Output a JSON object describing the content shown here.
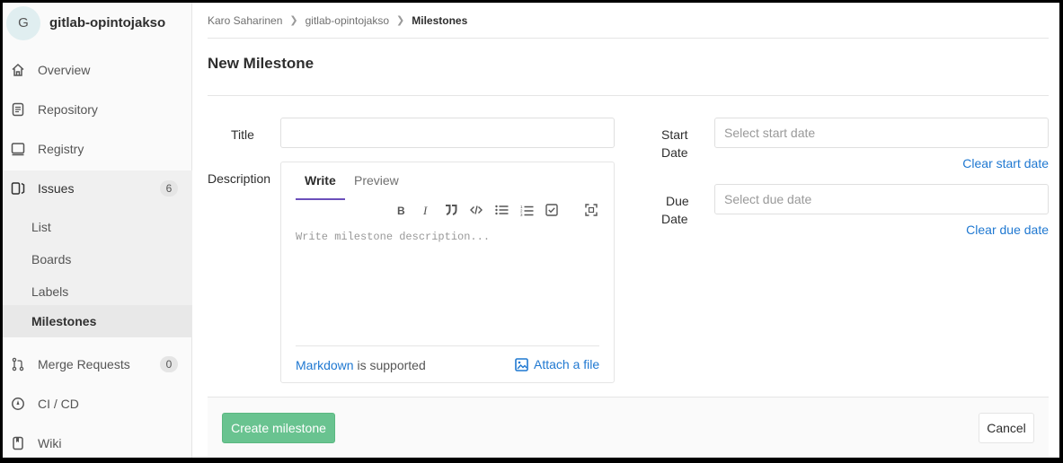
{
  "project": {
    "avatar_letter": "G",
    "name": "gitlab-opintojakso"
  },
  "sidebar": {
    "items": [
      {
        "label": "Overview",
        "icon": "home-icon"
      },
      {
        "label": "Repository",
        "icon": "doc-text-icon"
      },
      {
        "label": "Registry",
        "icon": "container-image-icon"
      },
      {
        "label": "Issues",
        "icon": "issues-icon",
        "count": "6"
      },
      {
        "label": "Merge Requests",
        "icon": "git-merge-icon",
        "count": "0"
      },
      {
        "label": "CI / CD",
        "icon": "rocket-icon"
      },
      {
        "label": "Wiki",
        "icon": "book-icon"
      }
    ],
    "issues_sub": [
      "List",
      "Boards",
      "Labels",
      "Milestones"
    ]
  },
  "breadcrumb": [
    "Karo Saharinen",
    "gitlab-opintojakso",
    "Milestones"
  ],
  "page_title": "New Milestone",
  "form": {
    "title_label": "Title",
    "description_label": "Description",
    "start_label_1": "Start",
    "start_label_2": "Date",
    "start_placeholder": "Select start date",
    "clear_start": "Clear start date",
    "due_label_1": "Due",
    "due_label_2": "Date",
    "due_placeholder": "Select due date",
    "clear_due": "Clear due date"
  },
  "editor": {
    "tab_write": "Write",
    "tab_preview": "Preview",
    "placeholder": "Write milestone description...",
    "markdown_link": "Markdown",
    "supported_text": " is supported",
    "attach_label": "Attach a file",
    "tools": [
      "bold-icon",
      "italic-icon",
      "quote-icon",
      "code-icon",
      "bullet-list-icon",
      "numbered-list-icon",
      "task-list-icon",
      "fullscreen-icon"
    ]
  },
  "buttons": {
    "create": "Create milestone",
    "cancel": "Cancel"
  },
  "colors": {
    "accent_purple": "#6b4fbb",
    "link_blue": "#1f78d1",
    "create_green": "#69c390"
  }
}
